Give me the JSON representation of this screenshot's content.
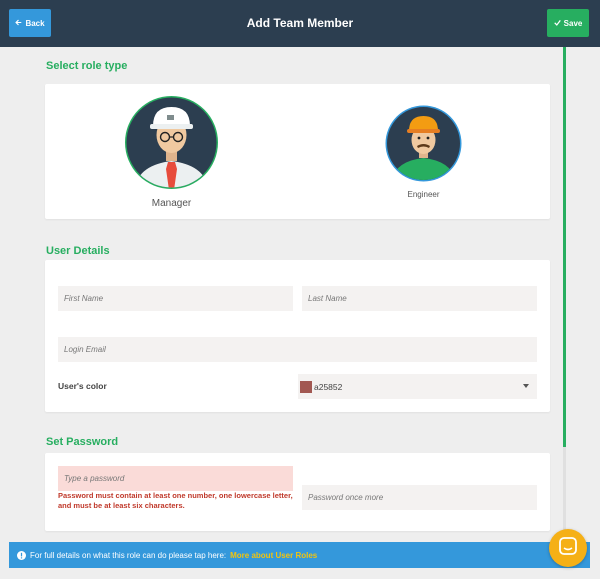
{
  "header": {
    "title": "Add Team Member",
    "back_label": "Back",
    "save_label": "Save"
  },
  "role_section": {
    "title": "Select role type",
    "roles": [
      {
        "label": "Manager",
        "selected": true
      },
      {
        "label": "Engineer",
        "selected": false
      }
    ]
  },
  "user_details": {
    "title": "User Details",
    "first_name_placeholder": "First Name",
    "last_name_placeholder": "Last Name",
    "email_placeholder": "Login Email",
    "color_label": "User's color",
    "color_value": "a25852",
    "color_hex": "#a25852"
  },
  "password": {
    "title": "Set Password",
    "password_placeholder": "Type a password",
    "confirm_placeholder": "Password once more",
    "error_message": "Password must contain at least one number, one lowercase letter, and must be at least six characters."
  },
  "info_bar": {
    "text": "For full details on what this role can do please tap here:",
    "link": "More about User Roles"
  },
  "colors": {
    "header": "#2c3e50",
    "accent_green": "#27ae60",
    "accent_blue": "#3498db",
    "error_red": "#c0392b"
  }
}
